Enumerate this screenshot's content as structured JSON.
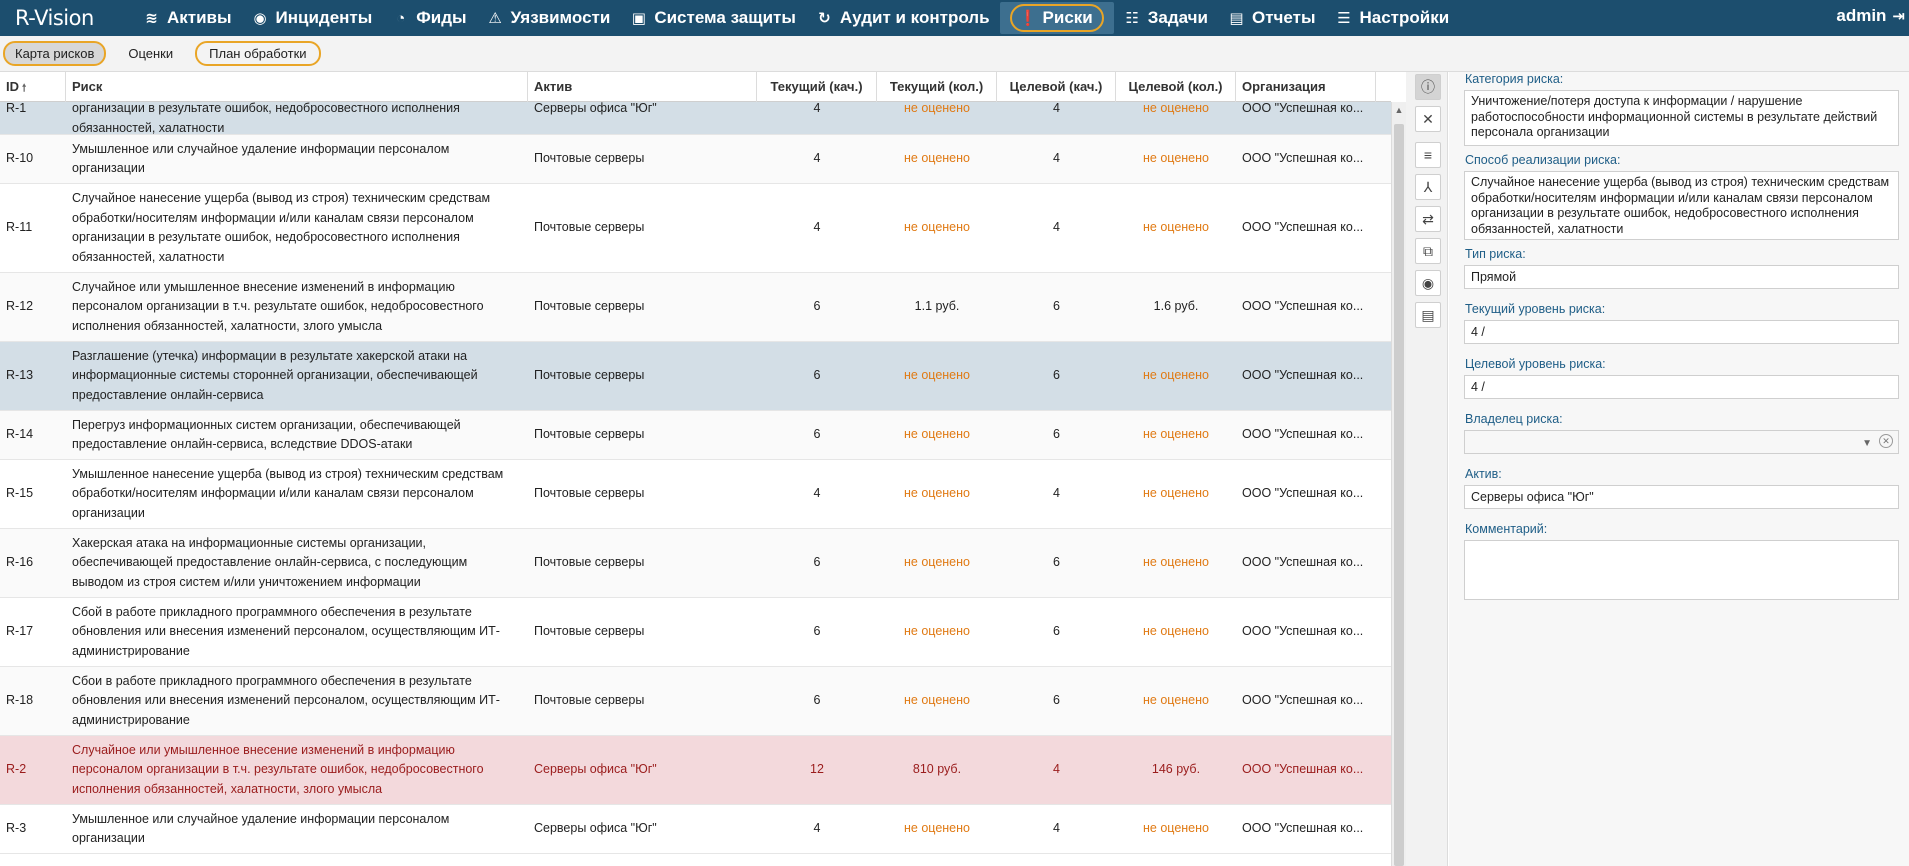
{
  "app": {
    "logo": "R-Vision",
    "user": "admin"
  },
  "nav": [
    {
      "label": "Активы",
      "icon": "database-icon",
      "glyph": "≋"
    },
    {
      "label": "Инциденты",
      "icon": "target-icon",
      "glyph": "◉"
    },
    {
      "label": "Фиды",
      "icon": "rss-icon",
      "glyph": "◔"
    },
    {
      "label": "Уязвимости",
      "icon": "warning-icon",
      "glyph": "⚠"
    },
    {
      "label": "Система защиты",
      "icon": "layers-icon",
      "glyph": "▣"
    },
    {
      "label": "Аудит и контроль",
      "icon": "refresh-icon",
      "glyph": "↻"
    },
    {
      "label": "Риски",
      "icon": "alert-circle-icon",
      "glyph": "❗"
    },
    {
      "label": "Задачи",
      "icon": "tasks-icon",
      "glyph": "☷"
    },
    {
      "label": "Отчеты",
      "icon": "report-icon",
      "glyph": "▤"
    },
    {
      "label": "Настройки",
      "icon": "menu-icon",
      "glyph": "☰"
    }
  ],
  "subtabs": [
    "Карта рисков",
    "Оценки",
    "План обработки"
  ],
  "table": {
    "columns": [
      "ID",
      "Риск",
      "Актив",
      "Текущий (кач.)",
      "Текущий (кол.)",
      "Целевой (кач.)",
      "Целевой (кол.)",
      "Организация"
    ],
    "rows": [
      {
        "id": "R-1",
        "risk": "обработки/носителям информации и/или каналам связи персоналом организации в результате ошибок, недобросовестного исполнения обязанностей, халатности",
        "asset": "Серверы офиса \"Юг\"",
        "cur_q": "4",
        "cur_k": "не оценено",
        "tgt_q": "4",
        "tgt_k": "не оценено",
        "org": "ООО \"Успешная ко...",
        "h": 51,
        "state": "sel"
      },
      {
        "id": "R-10",
        "risk": "Умышленное или случайное удаление информации персоналом организации",
        "asset": "Почтовые серверы",
        "cur_q": "4",
        "cur_k": "не оценено",
        "tgt_q": "4",
        "tgt_k": "не оценено",
        "org": "ООО \"Успешная ко...",
        "h": 49,
        "state": "alt"
      },
      {
        "id": "R-11",
        "risk": "Случайное нанесение ущерба (вывод из строя) техническим средствам обработки/носителям информации и/или каналам связи персоналом организации в результате ошибок, недобросовестного исполнения обязанностей, халатности",
        "asset": "Почтовые серверы",
        "cur_q": "4",
        "cur_k": "не оценено",
        "tgt_q": "4",
        "tgt_k": "не оценено",
        "org": "ООО \"Успешная ко...",
        "h": 89,
        "state": ""
      },
      {
        "id": "R-12",
        "risk": "Случайное или умышленное внесение изменений в информацию персоналом организации в т.ч. результате ошибок, недобросовестного исполнения обязанностей, халатности, злого умысла",
        "asset": "Почтовые серверы",
        "cur_q": "6",
        "cur_k": "1.1 руб.",
        "tgt_q": "6",
        "tgt_k": "1.6 руб.",
        "org": "ООО \"Успешная ко...",
        "h": 69,
        "state": "alt"
      },
      {
        "id": "R-13",
        "risk": "Разглашение (утечка) информации в результате хакерской атаки на информационные системы сторонней организации, обеспечивающей предоставление онлайн-сервиса",
        "asset": "Почтовые серверы",
        "cur_q": "6",
        "cur_k": "не оценено",
        "tgt_q": "6",
        "tgt_k": "не оценено",
        "org": "ООО \"Успешная ко...",
        "h": 69,
        "state": "sel"
      },
      {
        "id": "R-14",
        "risk": "Перегруз информационных систем организации, обеспечивающей предоставление онлайн-сервиса, вследствие DDOS-атаки",
        "asset": "Почтовые серверы",
        "cur_q": "6",
        "cur_k": "не оценено",
        "tgt_q": "6",
        "tgt_k": "не оценено",
        "org": "ООО \"Успешная ко...",
        "h": 49,
        "state": "alt"
      },
      {
        "id": "R-15",
        "risk": "Умышленное нанесение ущерба (вывод из строя) техническим средствам обработки/носителям информации и/или каналам связи персоналом организации",
        "asset": "Почтовые серверы",
        "cur_q": "4",
        "cur_k": "не оценено",
        "tgt_q": "4",
        "tgt_k": "не оценено",
        "org": "ООО \"Успешная ко...",
        "h": 69,
        "state": ""
      },
      {
        "id": "R-16",
        "risk": "Хакерская атака на информационные системы организации, обеспечивающей предоставление онлайн-сервиса, с последующим выводом из строя систем и/или уничтожением информации",
        "asset": "Почтовые серверы",
        "cur_q": "6",
        "cur_k": "не оценено",
        "tgt_q": "6",
        "tgt_k": "не оценено",
        "org": "ООО \"Успешная ко...",
        "h": 69,
        "state": "alt"
      },
      {
        "id": "R-17",
        "risk": "Сбой в работе прикладного программного обеспечения в результате обновления или внесения изменений персоналом, осуществляющим ИТ-администрирование",
        "asset": "Почтовые серверы",
        "cur_q": "6",
        "cur_k": "не оценено",
        "tgt_q": "6",
        "tgt_k": "не оценено",
        "org": "ООО \"Успешная ко...",
        "h": 69,
        "state": ""
      },
      {
        "id": "R-18",
        "risk": "Сбои в работе прикладного программного обеспечения в результате обновления или внесения изменений персоналом, осуществляющим ИТ-администрирование",
        "asset": "Почтовые серверы",
        "cur_q": "6",
        "cur_k": "не оценено",
        "tgt_q": "6",
        "tgt_k": "не оценено",
        "org": "ООО \"Успешная ко...",
        "h": 69,
        "state": "alt"
      },
      {
        "id": "R-2",
        "risk": "Случайное или умышленное внесение изменений в информацию персоналом организации в т.ч. результате ошибок, недобросовестного исполнения обязанностей, халатности, злого умысла",
        "asset": "Серверы офиса \"Юг\"",
        "cur_q": "12",
        "cur_k": "810 руб.",
        "tgt_q": "4",
        "tgt_k": "146 руб.",
        "org": "ООО \"Успешная ко...",
        "h": 69,
        "state": "danger"
      },
      {
        "id": "R-3",
        "risk": "Умышленное или случайное удаление информации персоналом организации",
        "asset": "Серверы офиса \"Юг\"",
        "cur_q": "4",
        "cur_k": "не оценено",
        "tgt_q": "4",
        "tgt_k": "не оценено",
        "org": "ООО \"Успешная ко...",
        "h": 49,
        "state": ""
      }
    ]
  },
  "details": {
    "category_label": "Категория риска:",
    "category_value": "Уничтожение/потеря доступа к информации / нарушение работоспособности информационной системы в результате действий персонала организации",
    "method_label": "Способ реализации риска:",
    "method_value": "Случайное нанесение ущерба (вывод из строя) техническим средствам обработки/носителям информации и/или каналам связи персоналом организации в результате ошибок, недобросовестного исполнения обязанностей, халатности",
    "type_label": "Тип риска:",
    "type_value": "Прямой",
    "current_label": "Текущий уровень риска:",
    "current_value": "4 /",
    "target_label": "Целевой уровень риска:",
    "target_value": "4 /",
    "owner_label": "Владелец риска:",
    "owner_value": "",
    "asset_label": "Актив:",
    "asset_value": "Серверы офиса \"Юг\"",
    "comment_label": "Комментарий:",
    "comment_value": ""
  },
  "colors": {
    "nav_bg": "#1c4e6e",
    "accent_ring": "#e9a526",
    "not_rated": "#e07a14",
    "danger_row": "#f3d9dc",
    "selected_row": "#d3dee6"
  }
}
